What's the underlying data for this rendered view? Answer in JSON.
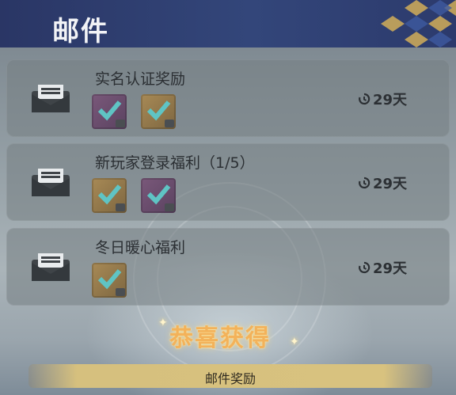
{
  "header": {
    "title": "邮件"
  },
  "mails": [
    {
      "title": "实名认证奖励",
      "items": [
        "purple",
        "gold"
      ],
      "expiry": "29天"
    },
    {
      "title": "新玩家登录福利（1/5）",
      "items": [
        "gold",
        "purple"
      ],
      "expiry": "29天"
    },
    {
      "title": "冬日暖心福利",
      "items": [
        "gold"
      ],
      "expiry": "29天"
    }
  ],
  "reward": {
    "banner": "恭喜获得",
    "ribbon_label": "邮件奖励"
  },
  "colors": {
    "header_bg": "#2f3f70",
    "title_text": "#f2f3f6",
    "banner_gold": "#f3b25a",
    "ribbon_gold": "#d6c07e",
    "check_teal": "#5fc4c4"
  },
  "icons": [
    "envelope-icon",
    "clock-icon",
    "checkmark-icon",
    "sparkle-icon"
  ]
}
